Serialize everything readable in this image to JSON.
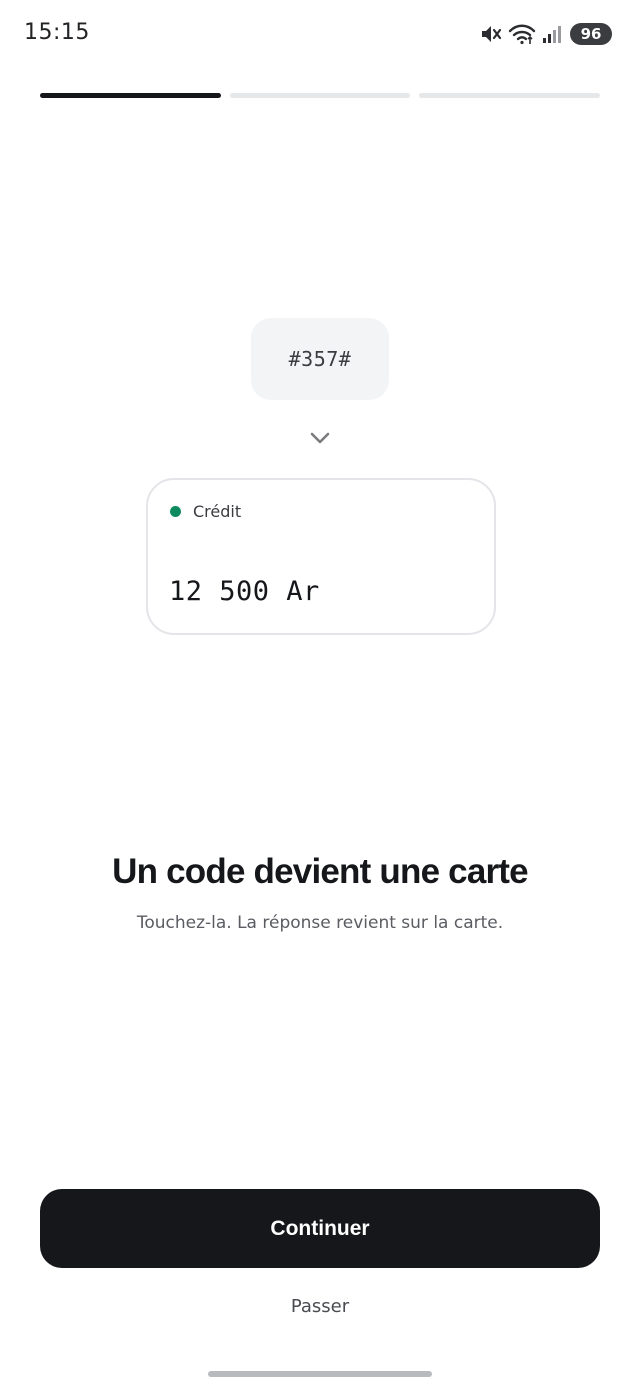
{
  "status_bar": {
    "time": "15:15",
    "icons": [
      "mute-icon",
      "wifi-icon",
      "signal-icon"
    ],
    "battery": "96"
  },
  "progress": {
    "steps_total": 3,
    "current_step": 1
  },
  "code_chip": {
    "code": "#357#"
  },
  "card": {
    "label": "Crédit",
    "amount": "12 500 Ar",
    "status_color": "#0e8a5f"
  },
  "content": {
    "title": "Un code devient une carte",
    "subtitle": "Touchez-la. La réponse revient sur la carte."
  },
  "actions": {
    "continue_label": "Continuer",
    "skip_label": "Passer"
  },
  "colors": {
    "primary": "#16171a",
    "accent_green": "#0e8a5f",
    "chip_bg": "#f3f4f6"
  }
}
